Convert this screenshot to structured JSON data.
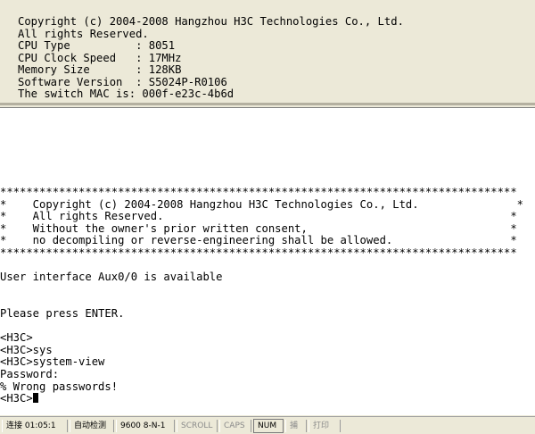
{
  "top_pane": {
    "lines": [
      "Copyright (c) 2004-2008 Hangzhou H3C Technologies Co., Ltd.",
      "All rights Reserved.",
      "CPU Type          : 8051",
      "CPU Clock Speed   : 17MHz",
      "Memory Size       : 128KB",
      "Software Version  : S5024P-R0106",
      "The switch MAC is: 000f-e23c-4b6d"
    ]
  },
  "terminal": {
    "lines": [
      "*******************************************************************************",
      "*    Copyright (c) 2004-2008 Hangzhou H3C Technologies Co., Ltd.               *",
      "*    All rights Reserved.                                                     *",
      "*    Without the owner's prior written consent,                               *",
      "*    no decompiling or reverse-engineering shall be allowed.                  *",
      "*******************************************************************************",
      "",
      "User interface Aux0/0 is available",
      "",
      "",
      "Please press ENTER.",
      "",
      "<H3C>",
      "<H3C>sys",
      "<H3C>system-view",
      "Password:",
      "% Wrong passwords!",
      "<H3C>"
    ]
  },
  "status_bar": {
    "connection": "连接 01:05:1",
    "detect": "自动检测",
    "serial_params": "9600 8-N-1",
    "scroll": "SCROLL",
    "caps": "CAPS",
    "num": "NUM",
    "capture": "捕",
    "print": "打印"
  }
}
